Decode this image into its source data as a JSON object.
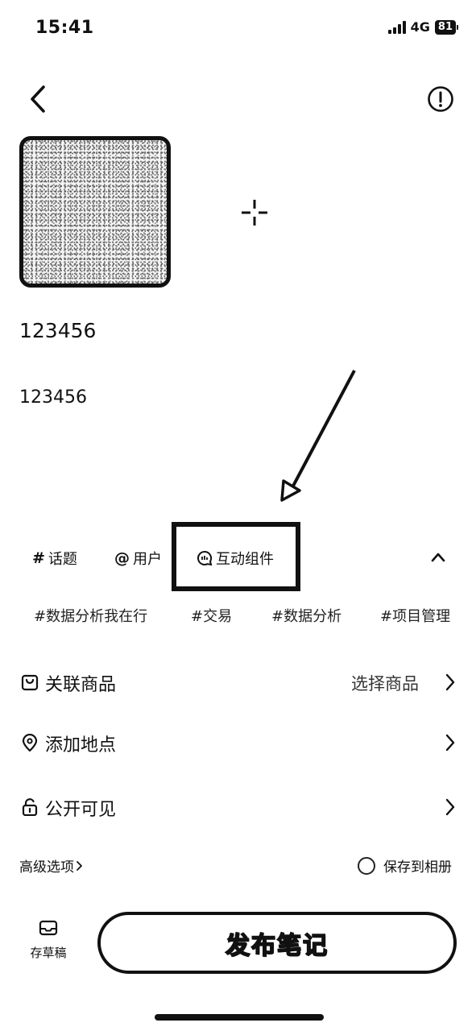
{
  "status_bar": {
    "time": "15:41",
    "network": "4G",
    "battery": "81"
  },
  "nav": {
    "back_icon": "chevron-left-icon",
    "info_icon": "exclamation-circle-icon"
  },
  "media": {
    "add_icon": "crosshair-plus-icon"
  },
  "note": {
    "title": "123456",
    "body": "123456"
  },
  "toolbar": {
    "topic": {
      "symbol": "#",
      "label": "话题"
    },
    "user": {
      "symbol": "@",
      "label": "用户"
    },
    "interactive": {
      "label": "互动组件",
      "icon": "chat-bubble-icon"
    },
    "collapse_icon": "chevron-up-icon"
  },
  "tags": [
    "#数据分析我在行",
    "#交易",
    "#数据分析",
    "#项目管理"
  ],
  "rows": {
    "product": {
      "label": "关联商品",
      "value": "选择商品",
      "icon": "bag-icon"
    },
    "location": {
      "label": "添加地点",
      "icon": "location-pin-icon"
    },
    "visibility": {
      "label": "公开可见",
      "icon": "unlock-icon"
    }
  },
  "options": {
    "advanced": "高级选项",
    "save_album": "保存到相册"
  },
  "bottom": {
    "draft": "存草稿",
    "draft_icon": "inbox-tray-icon",
    "publish": "发布笔记"
  }
}
